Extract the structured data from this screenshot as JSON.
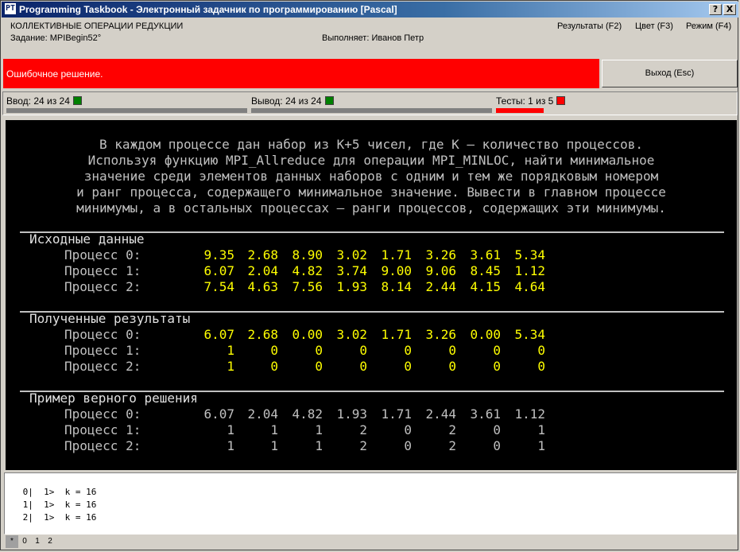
{
  "window": {
    "title": "Programming Taskbook - Электронный задачник по программированию [Pascal]",
    "icon_glyph": "PT",
    "help_label": "?",
    "close_label": "X"
  },
  "header": {
    "group_title": "КОЛЛЕКТИВНЫЕ ОПЕРАЦИИ РЕДУКЦИИ",
    "task_label": "Задание:",
    "task_name": "MPIBegin52°",
    "performer_label": "Выполняет:",
    "performer_name": "Иванов Петр",
    "menu_results": "Результаты (F2)",
    "menu_color": "Цвет (F3)",
    "menu_mode": "Режим (F4)"
  },
  "status": {
    "message": "Ошибочное решение.",
    "exit_label": "Выход (Esc)",
    "error_color": "#ff0000"
  },
  "counters": {
    "input_label": "Ввод: 24 из 24",
    "input_fill": 1.0,
    "output_label": "Вывод: 24 из 24",
    "output_fill": 1.0,
    "tests_label": "Тесты: 1 из 5",
    "tests_fill": 0.2,
    "ok_color": "#008000",
    "fail_color": "#ff0000"
  },
  "description": [
    "В каждом процессе дан набор из K+5 чисел, где K — количество процессов.",
    "Используя функцию MPI_Allreduce для операции MPI_MINLOC, найти минимальное",
    "значение среди элементов данных наборов с одним и тем же порядковым номером",
    "и ранг процесса, содержащего минимальное значение. Вывести в главном процессе",
    "минимумы, а в остальных процессах — ранги процессов, содержащих эти минимумы."
  ],
  "sections": [
    {
      "title": "Исходные данные",
      "color": "yellow",
      "rows": [
        {
          "label": "Процесс 0:",
          "values": [
            "9.35",
            "2.68",
            "8.90",
            "3.02",
            "1.71",
            "3.26",
            "3.61",
            "5.34"
          ]
        },
        {
          "label": "Процесс 1:",
          "values": [
            "6.07",
            "2.04",
            "4.82",
            "3.74",
            "9.00",
            "9.06",
            "8.45",
            "1.12"
          ]
        },
        {
          "label": "Процесс 2:",
          "values": [
            "7.54",
            "4.63",
            "7.56",
            "1.93",
            "8.14",
            "2.44",
            "4.15",
            "4.64"
          ]
        }
      ]
    },
    {
      "title": "Полученные результаты",
      "color": "yellow",
      "rows": [
        {
          "label": "Процесс 0:",
          "values": [
            "6.07",
            "2.68",
            "0.00",
            "3.02",
            "1.71",
            "3.26",
            "0.00",
            "5.34"
          ]
        },
        {
          "label": "Процесс 1:",
          "values": [
            "1",
            "0",
            "0",
            "0",
            "0",
            "0",
            "0",
            "0"
          ]
        },
        {
          "label": "Процесс 2:",
          "values": [
            "1",
            "0",
            "0",
            "0",
            "0",
            "0",
            "0",
            "0"
          ]
        }
      ]
    },
    {
      "title": "Пример верного решения",
      "color": "gray",
      "rows": [
        {
          "label": "Процесс 0:",
          "values": [
            "6.07",
            "2.04",
            "4.82",
            "1.93",
            "1.71",
            "2.44",
            "3.61",
            "1.12"
          ]
        },
        {
          "label": "Процесс 1:",
          "values": [
            "1",
            "1",
            "1",
            "2",
            "0",
            "2",
            "0",
            "1"
          ]
        },
        {
          "label": "Процесс 2:",
          "values": [
            "1",
            "1",
            "1",
            "2",
            "0",
            "2",
            "0",
            "1"
          ]
        }
      ]
    }
  ],
  "debug": {
    "lines": [
      " 0|  1>  k = 16",
      " 1|  1>  k = 16",
      " 2|  1>  k = 16"
    ],
    "tabs": [
      "*",
      "0",
      "1",
      "2"
    ]
  }
}
